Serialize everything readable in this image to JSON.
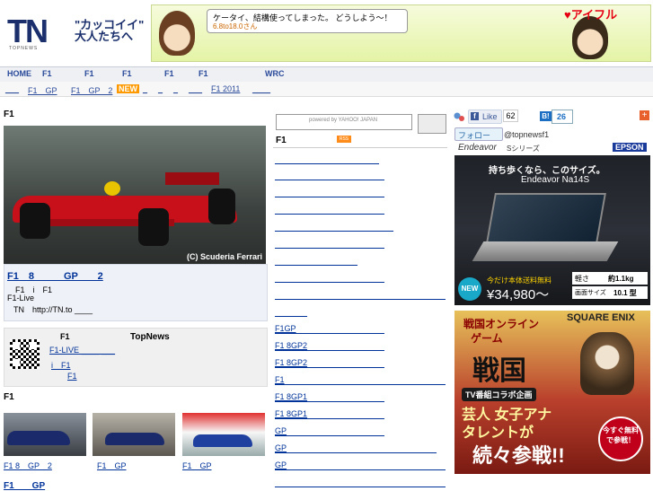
{
  "header": {
    "logo": "TN",
    "logo_sub": "TOPNEWS",
    "tagline_line1": "\"カッコイイ\"",
    "tagline_line2": "大人たちへ"
  },
  "banner": {
    "bubble_text": "ケータイ、結構使ってしまった。 どうしよう～！",
    "bubble_sub": "6.8to18.0さん",
    "brand": "♥アイフル"
  },
  "nav": {
    "items": [
      "HOME",
      "F1",
      "F1",
      "F1",
      "F1",
      "F1",
      "WRC"
    ]
  },
  "subnav": {
    "items": [
      "___",
      "F1　GP",
      "F1　GP　2",
      "NEW",
      "_",
      "_",
      "_",
      "___",
      "F1 2011",
      "____"
    ]
  },
  "left": {
    "section_title": "F1",
    "hero_credit": "(C) Scuderia Ferrari",
    "hero_headline": "F1　8　　　GP　　2",
    "hero_lines": [
      "F1　i　F1",
      "F1-Live",
      "TN　http://TN.to ____"
    ],
    "qr_title": "F1",
    "qr_brand": "TopNews",
    "qr_lines": [
      "F1-LIVE ____ ___",
      "i　F1",
      "F1"
    ],
    "section2_title": "F1",
    "thumb_captions": [
      "F1 8　GP　2",
      "F1　GP",
      "F1　GP"
    ],
    "bottom_headline": "F1　　GP"
  },
  "middle": {
    "search_placeholder": "powered by YAHOO! JAPAN",
    "header": "F1",
    "rss_label": "RSS",
    "links": [
      "",
      "",
      "",
      "",
      "",
      "",
      "",
      "",
      "",
      "",
      "F1GP",
      "F1 8GP2",
      "F1 8GP2",
      "F1",
      "F1 8GP1",
      "F1 8GP1",
      "GP",
      "GP",
      "GP",
      "",
      "",
      "GP",
      "DBS"
    ]
  },
  "right": {
    "fb_label": "Like",
    "fb_count": "62",
    "hatena_label": "B!",
    "hatena_count": "26",
    "follow_label": "フォロー",
    "twitter_handle": "@topnewsf1",
    "ad1": {
      "model": "Endeavor",
      "series": "Sシリーズ",
      "brand": "EPSON",
      "headline": "持ち歩くなら、このサイズ。",
      "sub": "Endeavor Na14S",
      "badge": "NEW",
      "price_note": "今だけ本体送料無料",
      "price": "¥34,980～",
      "spec1_label": "軽さ",
      "spec1_val": "約1.1kg",
      "spec2_label": "画面サイズ",
      "spec2_val": "10.1 型"
    },
    "ad2": {
      "title1": "戦国オンライン",
      "title2": "ゲーム",
      "brand": "SQUARE ENIX",
      "logo": "戦国",
      "collab": "TV番組コラボ企画",
      "line1": "芸人 女子アナ",
      "line2": "タレントが",
      "line3": "続々参戦!!",
      "cta": "今すぐ無料で参戦！"
    }
  },
  "colors": {
    "brand_navy": "#1a2f6b",
    "link": "#003399",
    "new_badge": "#ff9900"
  }
}
